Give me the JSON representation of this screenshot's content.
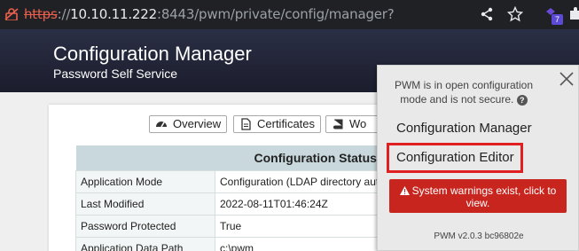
{
  "browser": {
    "url_scheme": "https",
    "url_sep": "://",
    "url_host": "10.10.11.222",
    "url_rest": ":8443/pwm/private/config/manager?",
    "extension_badge": "7",
    "icons": [
      "not-secure-lock-icon",
      "share-icon",
      "star-icon",
      "extension-icon",
      "puzzle-icon"
    ]
  },
  "header": {
    "title": "Configuration Manager",
    "subtitle": "Password Self Service"
  },
  "tabs": [
    {
      "label": "Overview",
      "icon": "dashboard-icon"
    },
    {
      "label": "Certificates",
      "icon": "document-icon"
    },
    {
      "label": "Wo",
      "icon": "book-icon"
    }
  ],
  "status_table": {
    "title": "Configuration Status",
    "rows": [
      {
        "key": "Application Mode",
        "value": "Configuration (LDAP directory aut"
      },
      {
        "key": "Last Modified",
        "value": "2022-08-11T01:46:24Z"
      },
      {
        "key": "Password Protected",
        "value": "True"
      },
      {
        "key": "Application Data Path",
        "value": "c:\\pwm"
      }
    ]
  },
  "menu": {
    "note": "PWM is in open configuration mode and is not secure.",
    "help": "?",
    "item_manager": "Configuration Manager",
    "item_editor": "Configuration Editor",
    "warning": "System warnings exist, click to view.",
    "version": "PWM v2.0.3 bc96802e"
  },
  "colors": {
    "highlight": "#e02020",
    "warning_bg": "#c9251f",
    "header_bg": "#1b1d2c"
  }
}
